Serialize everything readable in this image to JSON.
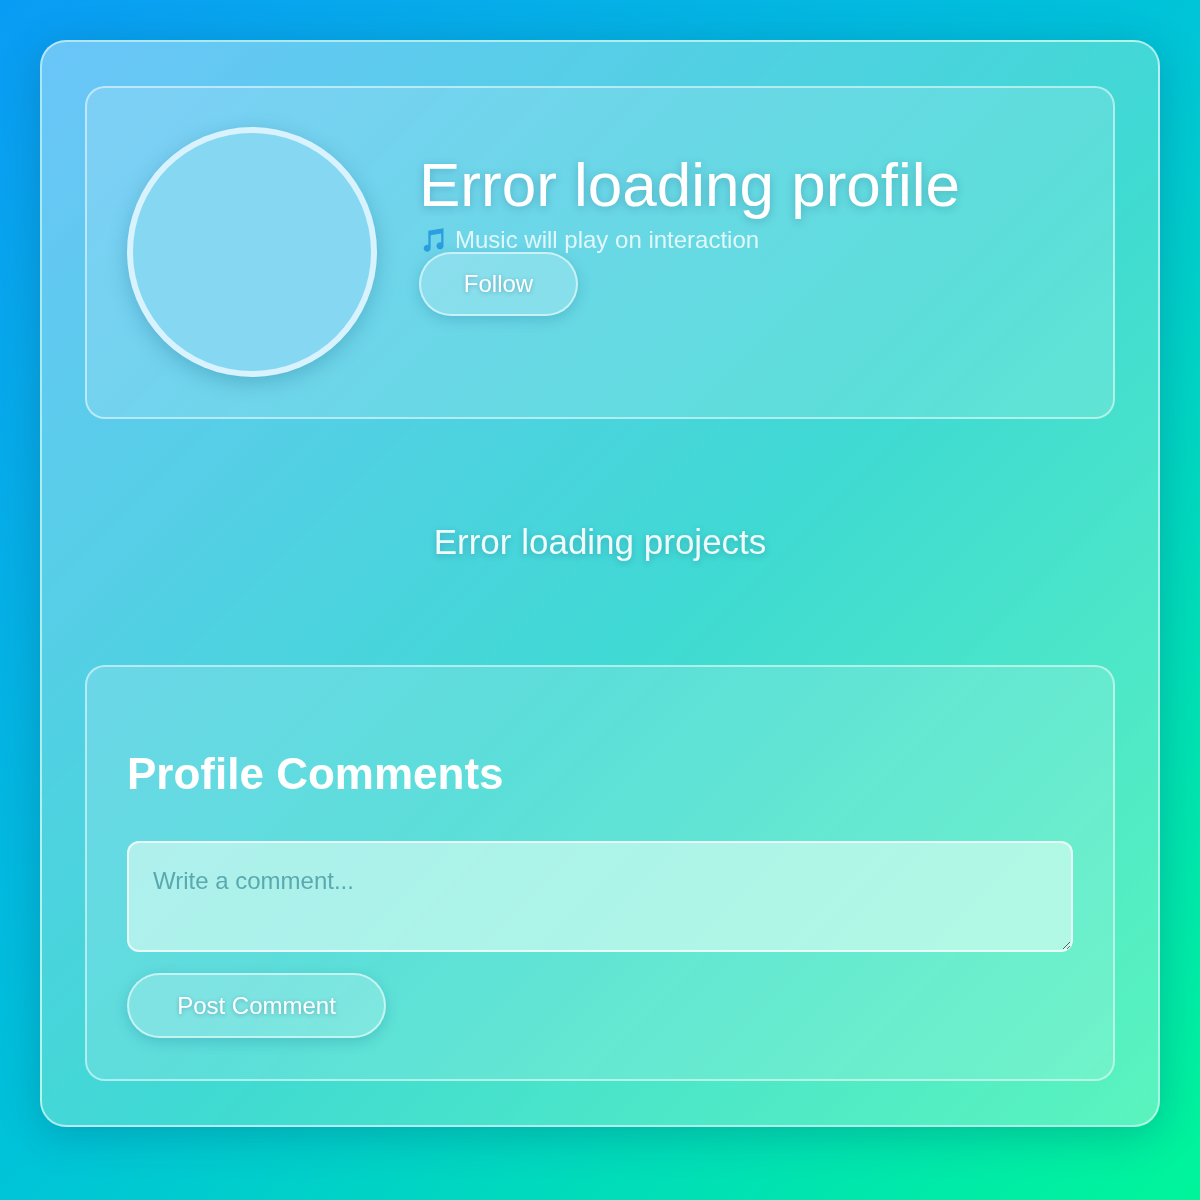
{
  "profile": {
    "title": "Error loading profile",
    "music_note": "Music will play on interaction",
    "follow_button": "Follow"
  },
  "projects": {
    "message": "Error loading projects"
  },
  "comments": {
    "heading": "Profile Comments",
    "comment_field": {
      "placeholder": "Write a comment..."
    },
    "post_button": "Post Comment"
  }
}
